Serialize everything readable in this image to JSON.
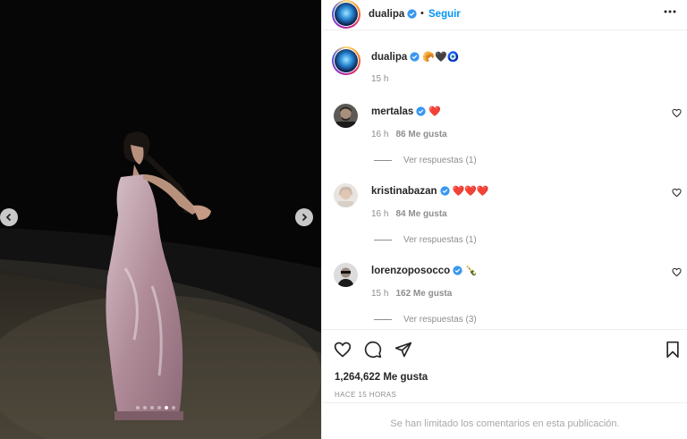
{
  "post": {
    "carousel_dots": 6,
    "active_dot": 4
  },
  "header": {
    "username": "dualipa",
    "separator": "•",
    "follow_label": "Seguir",
    "more_icon": "more-horizontal-icon"
  },
  "caption": {
    "username": "dualipa",
    "emojis": "🥐🖤🧿",
    "time": "15 h"
  },
  "comments": [
    {
      "username": "mertalas",
      "verified": true,
      "text": "❤️",
      "time": "16 h",
      "likes": "86 Me gusta",
      "replies": "Ver respuestas (1)"
    },
    {
      "username": "kristinabazan",
      "verified": true,
      "text": "❤️❤️❤️",
      "time": "16 h",
      "likes": "84 Me gusta",
      "replies": "Ver respuestas (1)"
    },
    {
      "username": "lorenzoposocco",
      "verified": true,
      "text": "🍾",
      "time": "15 h",
      "likes": "162 Me gusta",
      "replies": "Ver respuestas (3)"
    }
  ],
  "actions": {
    "like_icon": "heart-icon",
    "comment_icon": "comment-icon",
    "share_icon": "share-icon",
    "save_icon": "bookmark-icon",
    "likes_count": "1,264,622 Me gusta",
    "time_ago": "HACE 15 HORAS"
  },
  "footer": {
    "limited_text": "Se han limitado los comentarios en esta publicación."
  },
  "colors": {
    "accent": "#0095f6",
    "verified": "#3897f0",
    "heart": "#ed4956",
    "muted": "#8e8e8e"
  }
}
